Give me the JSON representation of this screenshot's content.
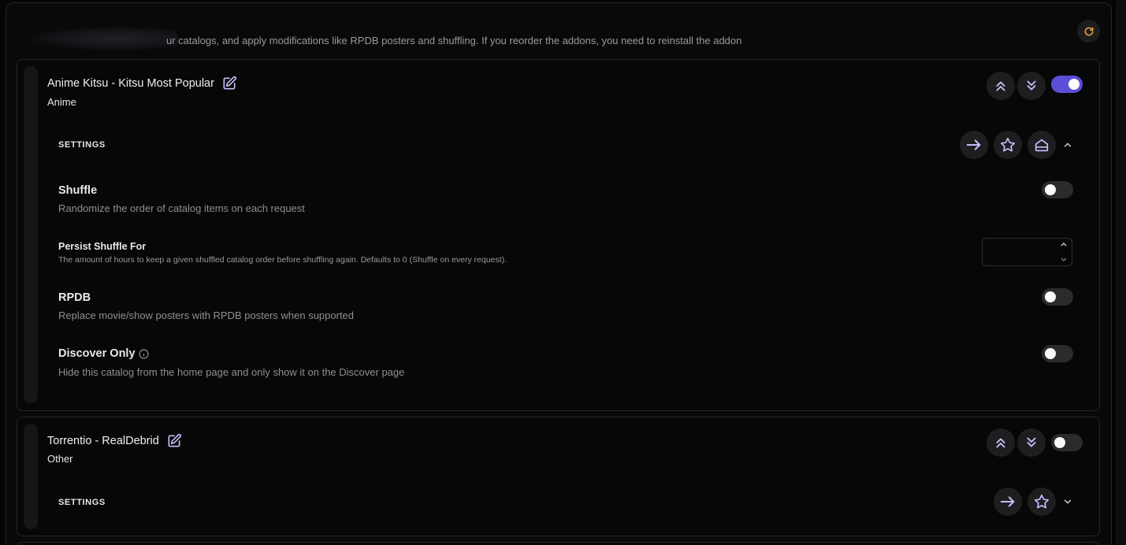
{
  "header": {
    "subtitle": "ur catalogs, and apply modifications like RPDB posters and shuffling. If you reorder the addons, you need to reinstall the addon",
    "refresh_icon": "refresh-icon"
  },
  "colors": {
    "accent": "#5b4fd6",
    "icon_accent": "#c8bffb",
    "refresh": "#f0a33c"
  },
  "catalogs": [
    {
      "title": "Anime Kitsu - Kitsu Most Popular",
      "type": "Anime",
      "enabled": true,
      "settings_label": "SETTINGS",
      "expanded": true,
      "options": {
        "shuffle": {
          "title": "Shuffle",
          "description": "Randomize the order of catalog items on each request",
          "enabled": false
        },
        "persist": {
          "title": "Persist Shuffle For",
          "description": "The amount of hours to keep a given shuffled catalog order before shuffling again. Defaults to 0 (Shuffle on every request).",
          "value": ""
        },
        "rpdb": {
          "title": "RPDB",
          "description": "Replace movie/show posters with RPDB posters when supported",
          "enabled": false
        },
        "discover": {
          "title": "Discover Only",
          "description": "Hide this catalog from the home page and only show it on the Discover page",
          "enabled": false
        }
      }
    },
    {
      "title": "Torrentio - RealDebrid",
      "type": "Other",
      "enabled": false,
      "settings_label": "SETTINGS",
      "expanded": false
    }
  ]
}
